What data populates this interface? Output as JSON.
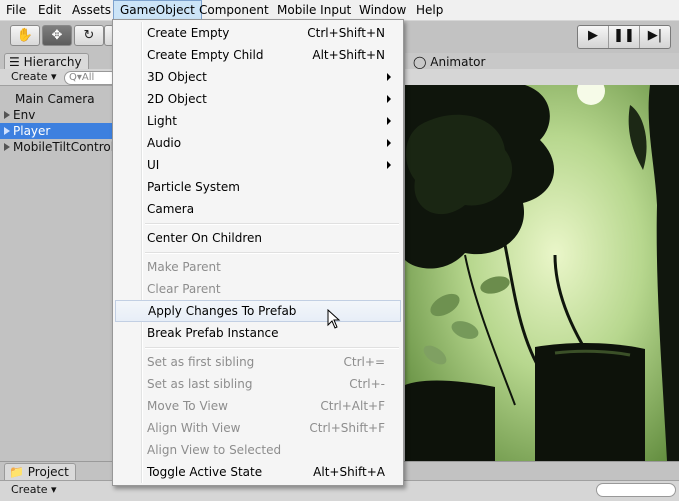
{
  "menubar": {
    "items": [
      "File",
      "Edit",
      "Assets",
      "GameObject",
      "Component",
      "Mobile Input",
      "Window",
      "Help"
    ]
  },
  "toolbar": {
    "tools": [
      "hand-tool",
      "move-tool",
      "rotate-tool"
    ],
    "play_buttons": [
      "play",
      "pause",
      "step"
    ]
  },
  "hierarchy": {
    "tab_label": "Hierarchy",
    "create_label": "Create",
    "search_placeholder": "Q▾All",
    "items": [
      {
        "label": "Main Camera",
        "expandable": false,
        "selected": false
      },
      {
        "label": "Env",
        "expandable": true,
        "selected": false
      },
      {
        "label": "Player",
        "expandable": true,
        "selected": true
      },
      {
        "label": "MobileTiltControll",
        "expandable": true,
        "selected": false
      }
    ]
  },
  "animator_tab": "Animator",
  "project": {
    "tab_label": "Project",
    "create_label": "Create"
  },
  "gameobject_menu": {
    "items": [
      {
        "label": "Create Empty",
        "shortcut": "Ctrl+Shift+N",
        "submenu": false,
        "disabled": false
      },
      {
        "label": "Create Empty Child",
        "shortcut": "Alt+Shift+N",
        "submenu": false,
        "disabled": false
      },
      {
        "label": "3D Object",
        "shortcut": "",
        "submenu": true,
        "disabled": false
      },
      {
        "label": "2D Object",
        "shortcut": "",
        "submenu": true,
        "disabled": false
      },
      {
        "label": "Light",
        "shortcut": "",
        "submenu": true,
        "disabled": false
      },
      {
        "label": "Audio",
        "shortcut": "",
        "submenu": true,
        "disabled": false
      },
      {
        "label": "UI",
        "shortcut": "",
        "submenu": true,
        "disabled": false
      },
      {
        "label": "Particle System",
        "shortcut": "",
        "submenu": false,
        "disabled": false
      },
      {
        "label": "Camera",
        "shortcut": "",
        "submenu": false,
        "disabled": false
      },
      {
        "label": "Center On Children",
        "shortcut": "",
        "submenu": false,
        "disabled": false
      },
      {
        "label": "Make Parent",
        "shortcut": "",
        "submenu": false,
        "disabled": true
      },
      {
        "label": "Clear Parent",
        "shortcut": "",
        "submenu": false,
        "disabled": true
      },
      {
        "label": "Apply Changes To Prefab",
        "shortcut": "",
        "submenu": false,
        "disabled": false,
        "hovered": true
      },
      {
        "label": "Break Prefab Instance",
        "shortcut": "",
        "submenu": false,
        "disabled": false
      },
      {
        "label": "Set as first sibling",
        "shortcut": "Ctrl+=",
        "submenu": false,
        "disabled": true
      },
      {
        "label": "Set as last sibling",
        "shortcut": "Ctrl+-",
        "submenu": false,
        "disabled": true
      },
      {
        "label": "Move To View",
        "shortcut": "Ctrl+Alt+F",
        "submenu": false,
        "disabled": true
      },
      {
        "label": "Align With View",
        "shortcut": "Ctrl+Shift+F",
        "submenu": false,
        "disabled": true
      },
      {
        "label": "Align View to Selected",
        "shortcut": "",
        "submenu": false,
        "disabled": true
      },
      {
        "label": "Toggle Active State",
        "shortcut": "Alt+Shift+A",
        "submenu": false,
        "disabled": false
      }
    ]
  }
}
